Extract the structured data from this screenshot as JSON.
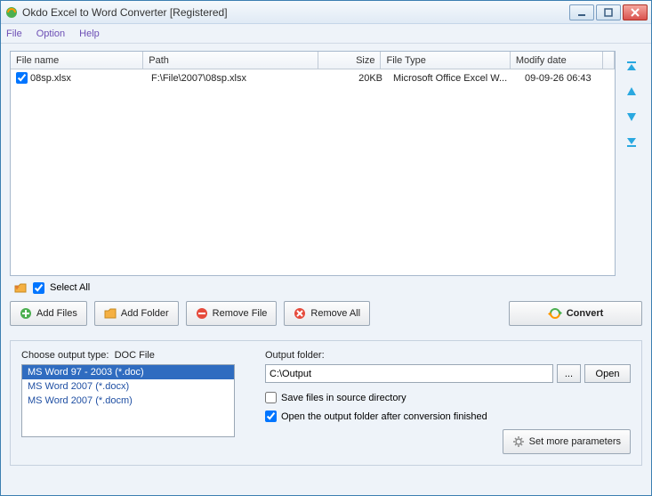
{
  "window": {
    "title": "Okdo Excel to Word Converter [Registered]"
  },
  "menu": {
    "file": "File",
    "option": "Option",
    "help": "Help"
  },
  "columns": {
    "filename": "File name",
    "path": "Path",
    "size": "Size",
    "filetype": "File Type",
    "modify": "Modify date"
  },
  "rows": [
    {
      "checked": true,
      "filename": "08sp.xlsx",
      "path": "F:\\File\\2007\\08sp.xlsx",
      "size": "20KB",
      "filetype": "Microsoft Office Excel W...",
      "modify": "09-09-26 06:43"
    }
  ],
  "selectAll": {
    "label": "Select All",
    "checked": true
  },
  "buttons": {
    "addFiles": "Add Files",
    "addFolder": "Add Folder",
    "removeFile": "Remove File",
    "removeAll": "Remove All",
    "convert": "Convert",
    "browse": "...",
    "open": "Open",
    "setMore": "Set more parameters"
  },
  "output": {
    "chooseLabel": "Choose output type:",
    "chooseValue": "DOC File",
    "options": [
      {
        "label": "MS Word 97 - 2003 (*.doc)",
        "selected": true
      },
      {
        "label": "MS Word 2007 (*.docx)",
        "selected": false
      },
      {
        "label": "MS Word 2007 (*.docm)",
        "selected": false
      }
    ],
    "folderLabel": "Output folder:",
    "folderValue": "C:\\Output",
    "saveSource": {
      "label": "Save files in source directory",
      "checked": false
    },
    "openAfter": {
      "label": "Open the output folder after conversion finished",
      "checked": true
    }
  }
}
